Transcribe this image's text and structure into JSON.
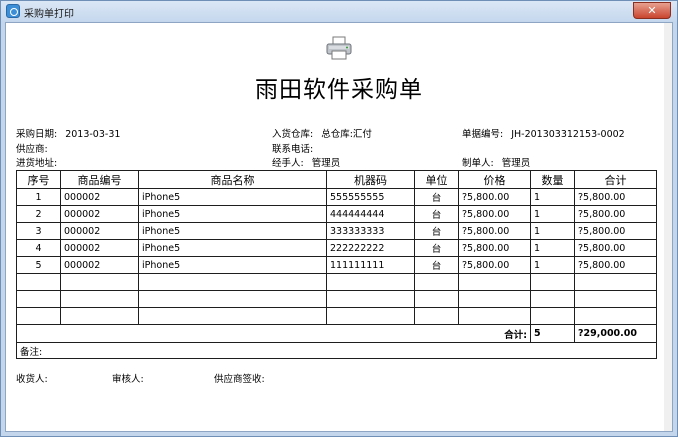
{
  "window": {
    "title": "采购单打印",
    "close_label": "✕"
  },
  "document": {
    "title": "雨田软件采购单",
    "info": {
      "purchase_date_label": "采购日期:",
      "purchase_date": "2013-03-31",
      "warehouse_label": "入货仓库:",
      "warehouse": "总仓库:汇付",
      "doc_no_label": "单据编号:",
      "doc_no": "JH-201303312153-0002",
      "supplier_label": "供应商:",
      "supplier": "",
      "phone_label": "联系电话:",
      "phone": "",
      "address_label": "进货地址:",
      "address": "",
      "handler_label": "经手人:",
      "handler": "管理员",
      "maker_label": "制单人:",
      "maker": "管理员"
    },
    "table": {
      "headers": [
        "序号",
        "商品编号",
        "商品名称",
        "机器码",
        "单位",
        "价格",
        "数量",
        "合计"
      ],
      "rows": [
        [
          "1",
          "000002",
          "iPhone5",
          "555555555",
          "台",
          "?5,800.00",
          "1",
          "?5,800.00"
        ],
        [
          "2",
          "000002",
          "iPhone5",
          "444444444",
          "台",
          "?5,800.00",
          "1",
          "?5,800.00"
        ],
        [
          "3",
          "000002",
          "iPhone5",
          "333333333",
          "台",
          "?5,800.00",
          "1",
          "?5,800.00"
        ],
        [
          "4",
          "000002",
          "iPhone5",
          "222222222",
          "台",
          "?5,800.00",
          "1",
          "?5,800.00"
        ],
        [
          "5",
          "000002",
          "iPhone5",
          "111111111",
          "台",
          "?5,800.00",
          "1",
          "?5,800.00"
        ]
      ],
      "total_label": "合计:",
      "total_qty": "5",
      "total_amount": "?29,000.00",
      "remark_label": "备注:"
    },
    "signatures": {
      "receiver": "收货人:",
      "reviewer": "审核人:",
      "supplier_sign": "供应商签收:"
    }
  }
}
